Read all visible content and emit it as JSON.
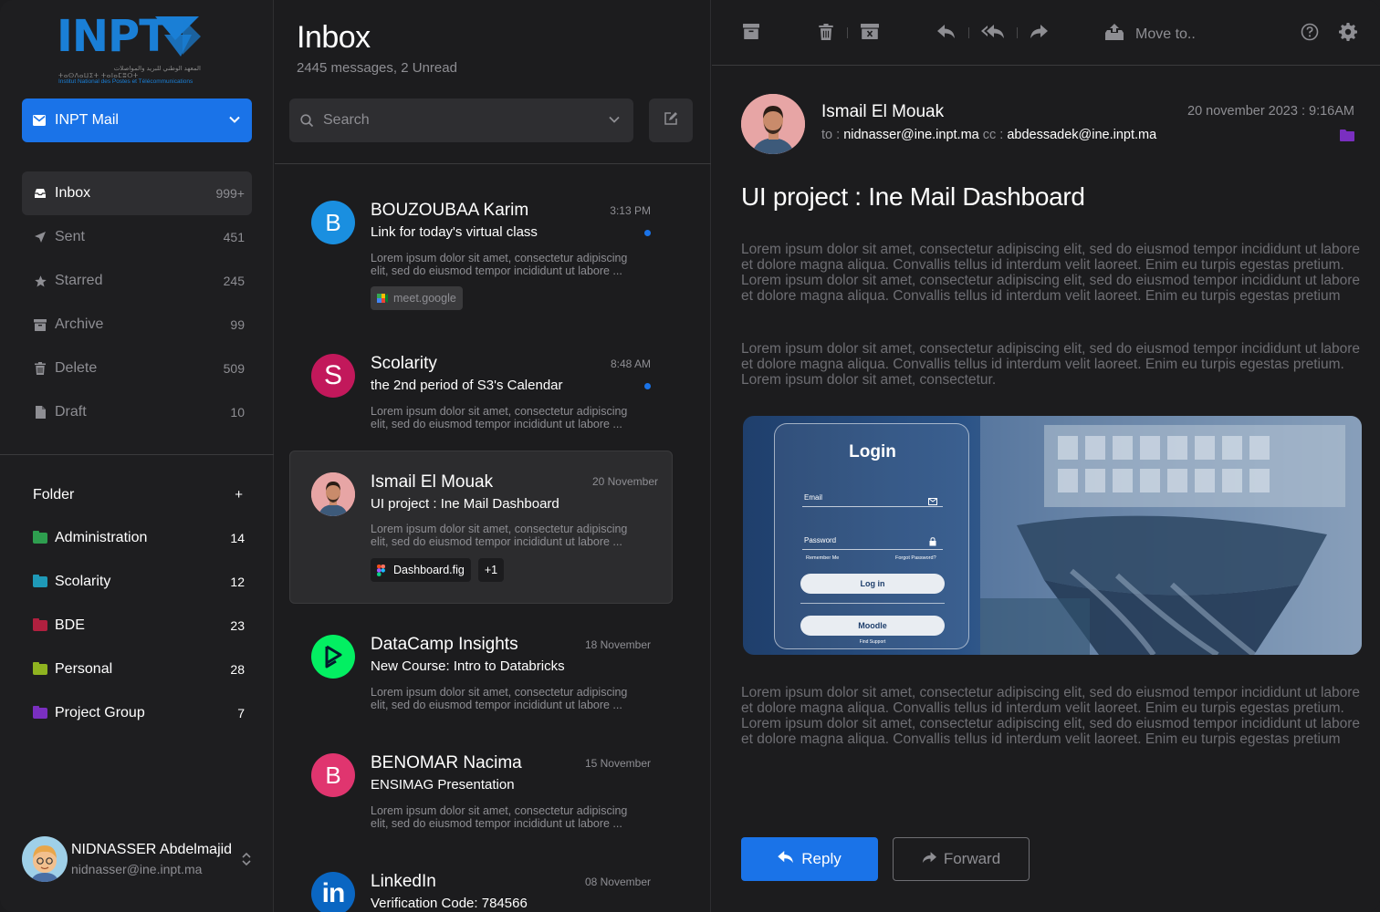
{
  "colors": {
    "accent": "#1a73e8",
    "background": "#1c1c1e",
    "unread_dot": "#1a73e8"
  },
  "logo": {
    "text": "INPT",
    "arabic": "المعهد الوطني للبريد والمواصلات",
    "tifinagh": "ⵜⴰⵙⴷⴰⵡⵉⵜ ⵜⴰⵏⴰⵎⵓⵔⵜ",
    "full": "Institut National des Postes et Télécommunications"
  },
  "sidebar": {
    "account": "INPT Mail",
    "nav": [
      {
        "label": "Inbox",
        "count": "999+",
        "icon": "inbox-icon"
      },
      {
        "label": "Sent",
        "count": "451",
        "icon": "send-icon"
      },
      {
        "label": "Starred",
        "count": "245",
        "icon": "star-icon"
      },
      {
        "label": "Archive",
        "count": "99",
        "icon": "archive-icon"
      },
      {
        "label": "Delete",
        "count": "509",
        "icon": "trash-icon"
      },
      {
        "label": "Draft",
        "count": "10",
        "icon": "draft-icon"
      }
    ],
    "folder_title": "Folder",
    "folder_add": "+",
    "folders": [
      {
        "label": "Administration",
        "count": "14",
        "color": "#2e9e4f"
      },
      {
        "label": "Scolarity",
        "count": "12",
        "color": "#1f9ab8"
      },
      {
        "label": "BDE",
        "count": "23",
        "color": "#b0203f"
      },
      {
        "label": "Personal",
        "count": "28",
        "color": "#8fb320"
      },
      {
        "label": "Project Group",
        "count": "7",
        "color": "#7a2fc0"
      }
    ],
    "user": {
      "name": "NIDNASSER Abdelmajid",
      "email": "nidnasser@ine.inpt.ma"
    }
  },
  "list": {
    "title": "Inbox",
    "subtitle": "2445 messages, 2 Unread",
    "search_placeholder": "Search",
    "mails": [
      {
        "from": "BOUZOUBAA Karim",
        "initial": "B",
        "avatar_color": "#1a8fe0",
        "time": "3:13 PM",
        "subject": "Link for today's virtual class",
        "preview": "Lorem ipsum dolor sit amet, consectetur adipiscing elit, sed do eiusmod tempor incididunt ut labore ...",
        "unread": true,
        "chips": [
          "meet.google"
        ]
      },
      {
        "from": "Scolarity",
        "initial": "S",
        "avatar_color": "#c2185b",
        "time": "8:48 AM",
        "subject": "the 2nd period of S3's Calendar",
        "preview": "Lorem ipsum dolor sit amet, consectetur adipiscing elit, sed do eiusmod tempor incididunt ut labore ...",
        "unread": true,
        "chips": []
      },
      {
        "from": "Ismail El Mouak",
        "initial": "",
        "avatar_color": "#e7a5a5",
        "time": "20 November",
        "subject": "UI project : Ine Mail Dashboard",
        "preview": "Lorem ipsum dolor sit amet, consectetur adipiscing elit, sed do eiusmod tempor incididunt ut labore ...",
        "unread": false,
        "chips": [
          "Dashboard.fig",
          "+1"
        ]
      },
      {
        "from": "DataCamp Insights",
        "initial": "",
        "avatar_color": "#03ef62",
        "time": "18 November",
        "subject": "New Course: Intro to Databricks",
        "preview": "Lorem ipsum dolor sit amet, consectetur adipiscing elit, sed do eiusmod tempor incididunt ut labore ...",
        "unread": false,
        "chips": []
      },
      {
        "from": "BENOMAR Nacima",
        "initial": "B",
        "avatar_color": "#e0356f",
        "time": "15 November",
        "subject": "ENSIMAG Presentation",
        "preview": "Lorem ipsum dolor sit amet, consectetur adipiscing elit, sed do eiusmod tempor incididunt ut labore ...",
        "unread": false,
        "chips": []
      },
      {
        "from": "LinkedIn",
        "initial": "in",
        "avatar_color": "#0a66c2",
        "time": "08 November",
        "subject": "Verification Code: 784566",
        "preview": "",
        "unread": false,
        "chips": []
      }
    ]
  },
  "reader": {
    "toolbar": {
      "move_to": "Move to.."
    },
    "sender": "Ismail El Mouak",
    "to_label": "to :",
    "to": "nidnasser@ine.inpt.ma",
    "cc_label": "cc :",
    "cc": "abdessadek@ine.inpt.ma",
    "date": "20 november 2023 : 9:16AM",
    "title": "UI project : Ine Mail Dashboard",
    "paragraphs": [
      "Lorem ipsum dolor sit amet, consectetur adipiscing elit, sed do eiusmod tempor incididunt ut labore et dolore magna aliqua. Convallis tellus id interdum velit laoreet. Enim eu turpis egestas pretium. Lorem ipsum dolor sit amet, consectetur adipiscing elit, sed do eiusmod tempor incididunt ut labore et dolore magna aliqua. Convallis tellus id interdum velit laoreet. Enim eu turpis egestas pretium",
      "Lorem ipsum dolor sit amet, consectetur adipiscing elit, sed do eiusmod tempor incididunt ut labore et dolore magna aliqua. Convallis tellus id interdum velit laoreet. Enim eu turpis egestas pretium. Lorem ipsum dolor sit amet, consectetur.",
      "Lorem ipsum dolor sit amet, consectetur adipiscing elit, sed do eiusmod tempor incididunt ut labore et dolore magna aliqua. Convallis tellus id interdum velit laoreet. Enim eu turpis egestas pretium. Lorem ipsum dolor sit amet, consectetur adipiscing elit, sed do eiusmod tempor incididunt ut labore et dolore magna aliqua. Convallis tellus id interdum velit laoreet. Enim eu turpis egestas pretium"
    ],
    "image": {
      "login_title": "Login",
      "email": "Email",
      "password": "Password",
      "remember": "Remember Me",
      "forgot": "Forgot Password?",
      "login_btn": "Log in",
      "moodle_btn": "Moodle",
      "support": "Find Support"
    },
    "reply": "Reply",
    "forward": "Forward"
  }
}
